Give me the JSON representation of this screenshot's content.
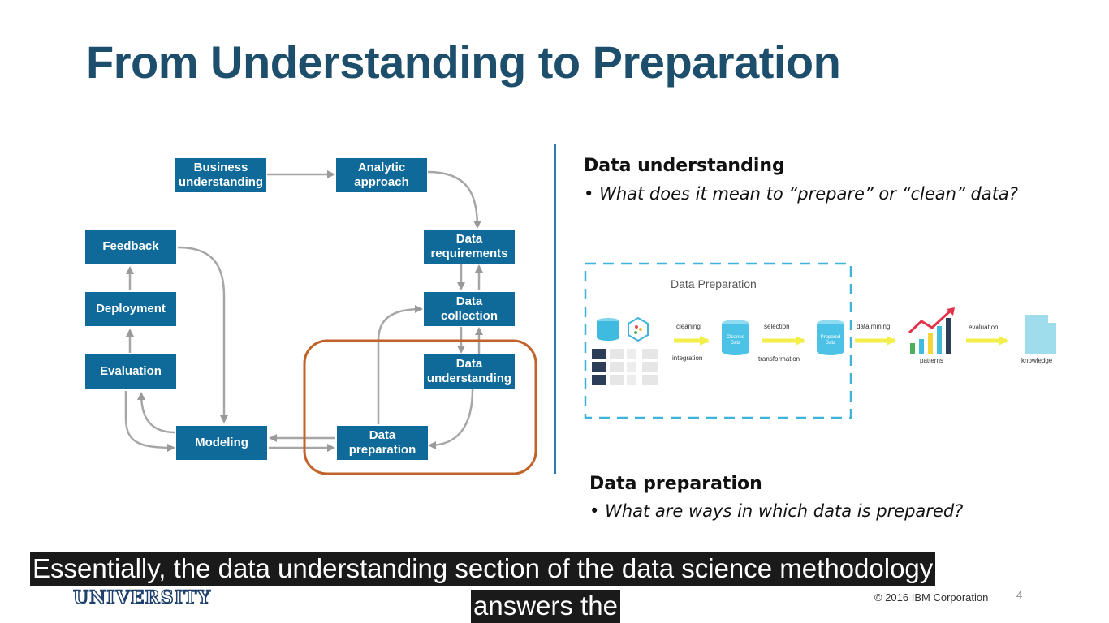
{
  "slide": {
    "title": "From Understanding to Preparation",
    "page_number": "4",
    "copyright": "© 2016 IBM Corporation",
    "logo_text": "UNIVERSITY",
    "accent_color": "#0f6a9a",
    "title_color": "#1d4e6c",
    "highlight_color": "#c0622a"
  },
  "diagram": {
    "nodes": {
      "business": "Business understanding",
      "analytic": "Analytic approach",
      "requirements": "Data requirements",
      "collection": "Data collection",
      "understanding": "Data understanding",
      "preparation": "Data preparation",
      "modeling": "Modeling",
      "evaluation": "Evaluation",
      "deployment": "Deployment",
      "feedback": "Feedback"
    }
  },
  "right": {
    "understanding_heading": "Data understanding",
    "understanding_bullet": "What does it mean to “prepare” or “clean” data?",
    "preparation_heading": "Data preparation",
    "preparation_bullet": "What are ways in which data is prepared?",
    "figure": {
      "title": "Data Preparation",
      "cleaning": "cleaning",
      "integration": "integration",
      "cleaned_data": "Cleaned Data",
      "selection": "selection",
      "transformation": "transformation",
      "prepared_data": "Prepared Data",
      "data_mining": "data mining",
      "patterns": "patterns",
      "evaluation": "evaluation",
      "knowledge": "knowledge"
    }
  },
  "captions": {
    "line1": "Essentially, the data understanding section of the data science methodology",
    "line2": "answers the"
  }
}
